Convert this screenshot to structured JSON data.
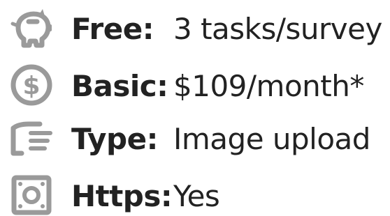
{
  "rows": [
    {
      "icon": "piggy-bank-icon",
      "label": "Free:",
      "value": "3 tasks/survey"
    },
    {
      "icon": "dollar-coin-icon",
      "label": "Basic:",
      "value": "$109/month*"
    },
    {
      "icon": "hand-upload-icon",
      "label": "Type:",
      "value": "Image upload"
    },
    {
      "icon": "secure-lock-icon",
      "label": "Https:",
      "value": "Yes"
    }
  ],
  "colors": {
    "icon": "#9a9a9a",
    "text": "#222222"
  }
}
